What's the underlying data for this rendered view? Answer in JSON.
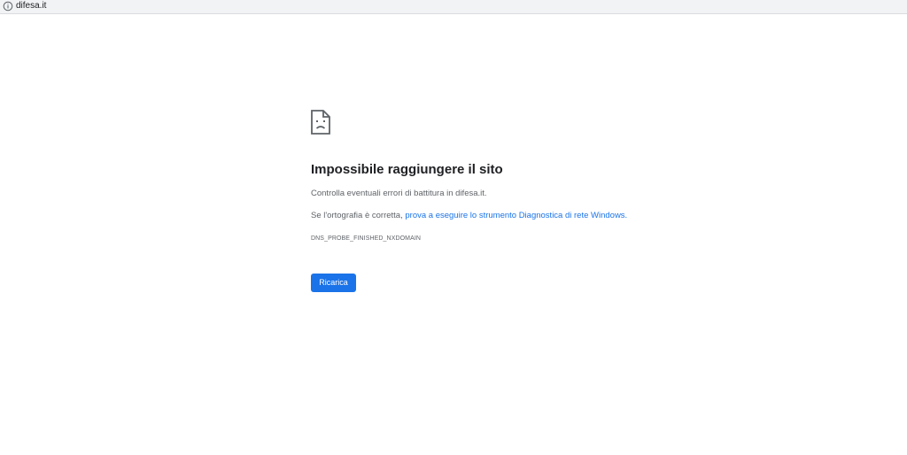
{
  "browser": {
    "url": "difesa.it",
    "icon": "info-icon"
  },
  "error_page": {
    "icon": "sad-page-icon",
    "title": "Impossibile raggiungere il sito",
    "suggestion_1": "Controlla eventuali errori di battitura in difesa.it.",
    "suggestion_2_prefix": "Se l'ortografia è corretta, ",
    "diagnostics_link": "prova a eseguire lo strumento Diagnostica di rete Windows.",
    "error_code": "DNS_PROBE_FINISHED_NXDOMAIN",
    "reload_label": "Ricarica",
    "colors": {
      "accent": "#1a73e8",
      "text": "#202124",
      "secondary_text": "#5f6368"
    }
  }
}
